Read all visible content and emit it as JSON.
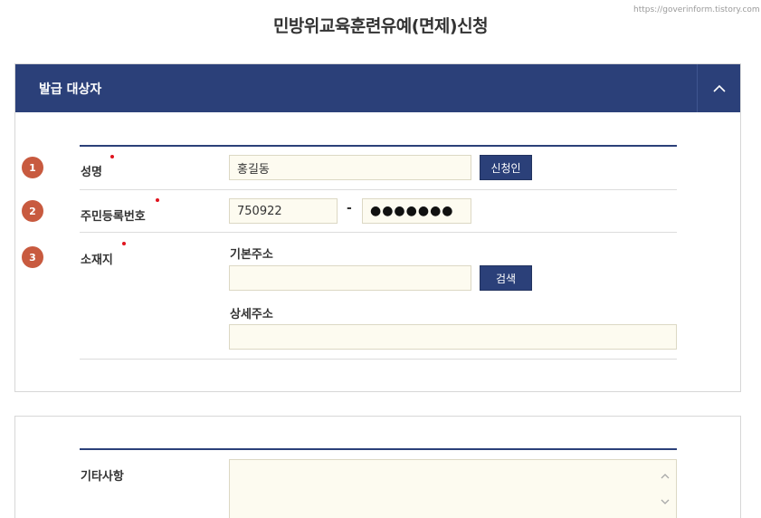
{
  "watermark": "https://goverinform.tistory.com",
  "page_title": "민방위교육훈련유예(면제)신청",
  "section1": {
    "title": "발급 대상자",
    "collapse_icon": "chevron-up-icon",
    "rows": {
      "name": {
        "step": "1",
        "label": "성명",
        "value": "홍길동",
        "button": "신청인"
      },
      "rrn": {
        "step": "2",
        "label": "주민등록번호",
        "front": "750922",
        "separator": "-",
        "back": "●●●●●●●"
      },
      "address": {
        "step": "3",
        "label": "소재지",
        "basic_label": "기본주소",
        "basic_value": "",
        "search_button": "검색",
        "detail_label": "상세주소",
        "detail_value": ""
      }
    }
  },
  "section2": {
    "etc_label": "기타사항",
    "etc_value": ""
  },
  "colors": {
    "navy": "#2b4079",
    "badge": "#c85a3f",
    "required": "#e0141e",
    "input_bg": "#fdfbf0"
  }
}
